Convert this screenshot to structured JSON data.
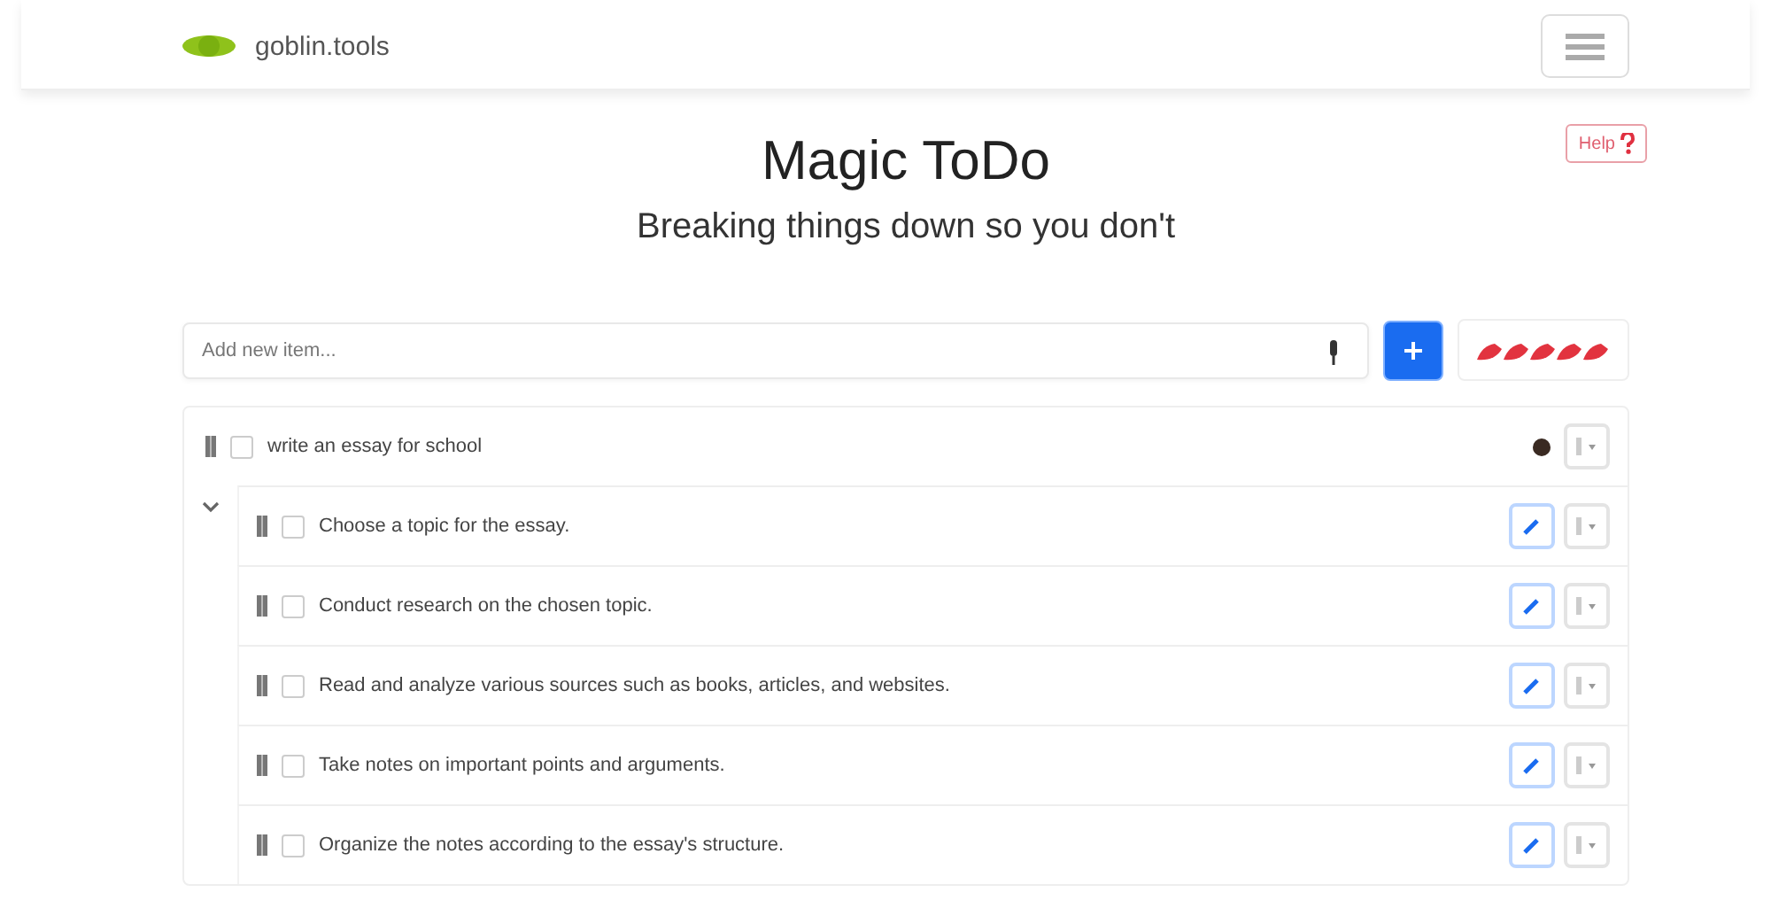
{
  "brand": {
    "name": "goblin.tools"
  },
  "help_button": "Help",
  "title": "Magic ToDo",
  "subtitle": "Breaking things down so you don't",
  "new_item": {
    "placeholder": "Add new item..."
  },
  "spiciness": {
    "stars": 5
  },
  "tasks": [
    {
      "text": "write an essay for school",
      "checked": false,
      "expanded": true,
      "children": [
        {
          "text": "Choose a topic for the essay.",
          "checked": false
        },
        {
          "text": "Conduct research on the chosen topic.",
          "checked": false
        },
        {
          "text": "Read and analyze various sources such as books, articles, and websites.",
          "checked": false
        },
        {
          "text": "Take notes on important points and arguments.",
          "checked": false
        },
        {
          "text": "Organize the notes according to the essay's structure.",
          "checked": false
        }
      ]
    }
  ]
}
